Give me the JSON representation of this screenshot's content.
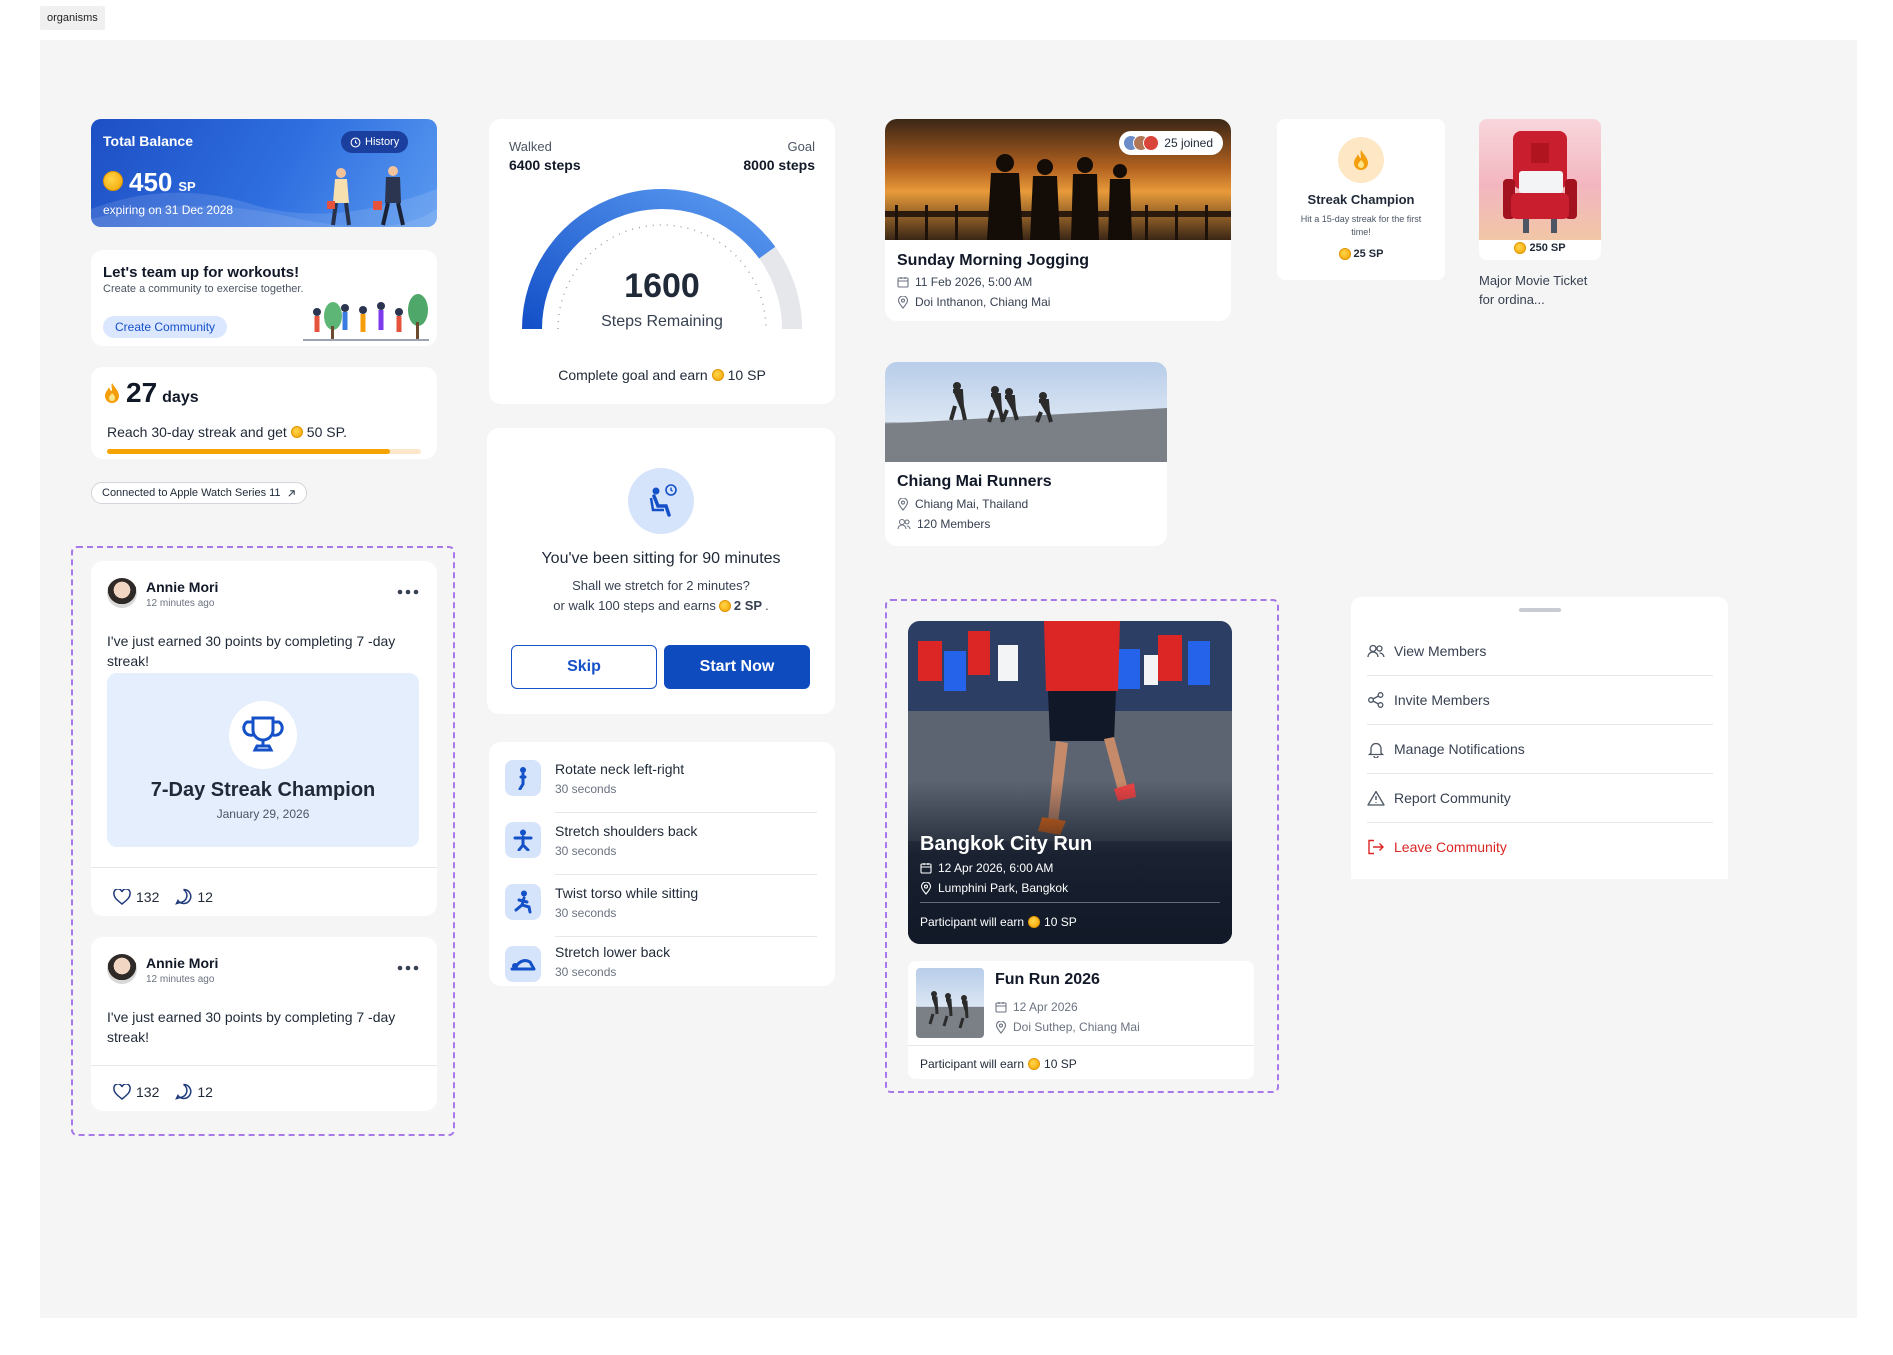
{
  "frame_label": "organisms",
  "balance": {
    "title": "Total Balance",
    "history_label": "History",
    "amount": "450",
    "unit": "SP",
    "expiry": "expiring on 31 Dec 2028"
  },
  "team_up": {
    "title": "Let's team up for workouts!",
    "subtitle": "Create a community to exercise together.",
    "button": "Create Community"
  },
  "streak": {
    "days": "27",
    "days_label": "days",
    "text_before": "Reach 30-day streak and get",
    "reward": "50 SP.",
    "progress": 0.9
  },
  "watch": {
    "label": "Connected to Apple Watch Series 11"
  },
  "posts": [
    {
      "author": "Annie Mori",
      "time": "12 minutes ago",
      "text": "I've just earned 30 points by completing 7 -day streak!",
      "badge_title": "7-Day Streak Champion",
      "badge_date": "January 29, 2026",
      "likes": "132",
      "comments": "12"
    },
    {
      "author": "Annie Mori",
      "time": "12 minutes ago",
      "text": "I've just earned 30 points by completing 7 -day streak!",
      "likes": "132",
      "comments": "12"
    }
  ],
  "steps": {
    "walked_label": "Walked",
    "walked_value": "6400 steps",
    "goal_label": "Goal",
    "goal_value": "8000 steps",
    "remaining": "1600",
    "remaining_label": "Steps Remaining",
    "footer": "Complete goal and earn",
    "footer_reward": "10 SP",
    "progress": 0.8
  },
  "sitting": {
    "title": "You've been sitting for 90 minutes",
    "line1": "Shall we stretch for 2 minutes?",
    "line2": "or walk 100 steps and earns",
    "reward": "2 SP",
    "reward_suffix": ".",
    "skip": "Skip",
    "start": "Start Now"
  },
  "stretches": [
    {
      "name": "Rotate neck left-right",
      "duration": "30 seconds"
    },
    {
      "name": "Stretch shoulders back",
      "duration": "30 seconds"
    },
    {
      "name": "Twist torso while sitting",
      "duration": "30 seconds"
    },
    {
      "name": "Stretch lower back",
      "duration": "30 seconds"
    }
  ],
  "event_jogging": {
    "joined": "25 joined",
    "title": "Sunday Morning Jogging",
    "date": "11 Feb 2026, 5:00 AM",
    "location": "Doi Inthanon, Chiang Mai"
  },
  "community_runners": {
    "title": "Chiang Mai Runners",
    "location": "Chiang Mai, Thailand",
    "members": "120 Members"
  },
  "badge_streak": {
    "title": "Streak Champion",
    "subtitle": "Hit a 15-day streak for the first time!",
    "reward": "25 SP"
  },
  "reward_movie": {
    "price": "250 SP",
    "title": "Major Movie Ticket for ordina..."
  },
  "bangkok_run": {
    "title": "Bangkok City Run",
    "date": "12 Apr 2026, 6:00 AM",
    "location": "Lumphini Park, Bangkok",
    "earn_label": "Participant will earn",
    "earn_value": "10 SP"
  },
  "fun_run": {
    "title": "Fun Run 2026",
    "date": "12 Apr 2026",
    "location": "Doi Suthep, Chiang Mai",
    "earn_label": "Participant will earn",
    "earn_value": "10 SP"
  },
  "menu": {
    "items": [
      {
        "label": "View Members",
        "icon": "members-icon"
      },
      {
        "label": "Invite Members",
        "icon": "share-icon"
      },
      {
        "label": "Manage Notifications",
        "icon": "bell-icon"
      },
      {
        "label": "Report Community",
        "icon": "warning-icon"
      },
      {
        "label": "Leave Community",
        "icon": "logout-icon"
      }
    ]
  },
  "colors": {
    "primary": "#1450c8",
    "accent_orange": "#f59e0b",
    "danger": "#dc2626",
    "dashed_border": "#a778e8"
  }
}
